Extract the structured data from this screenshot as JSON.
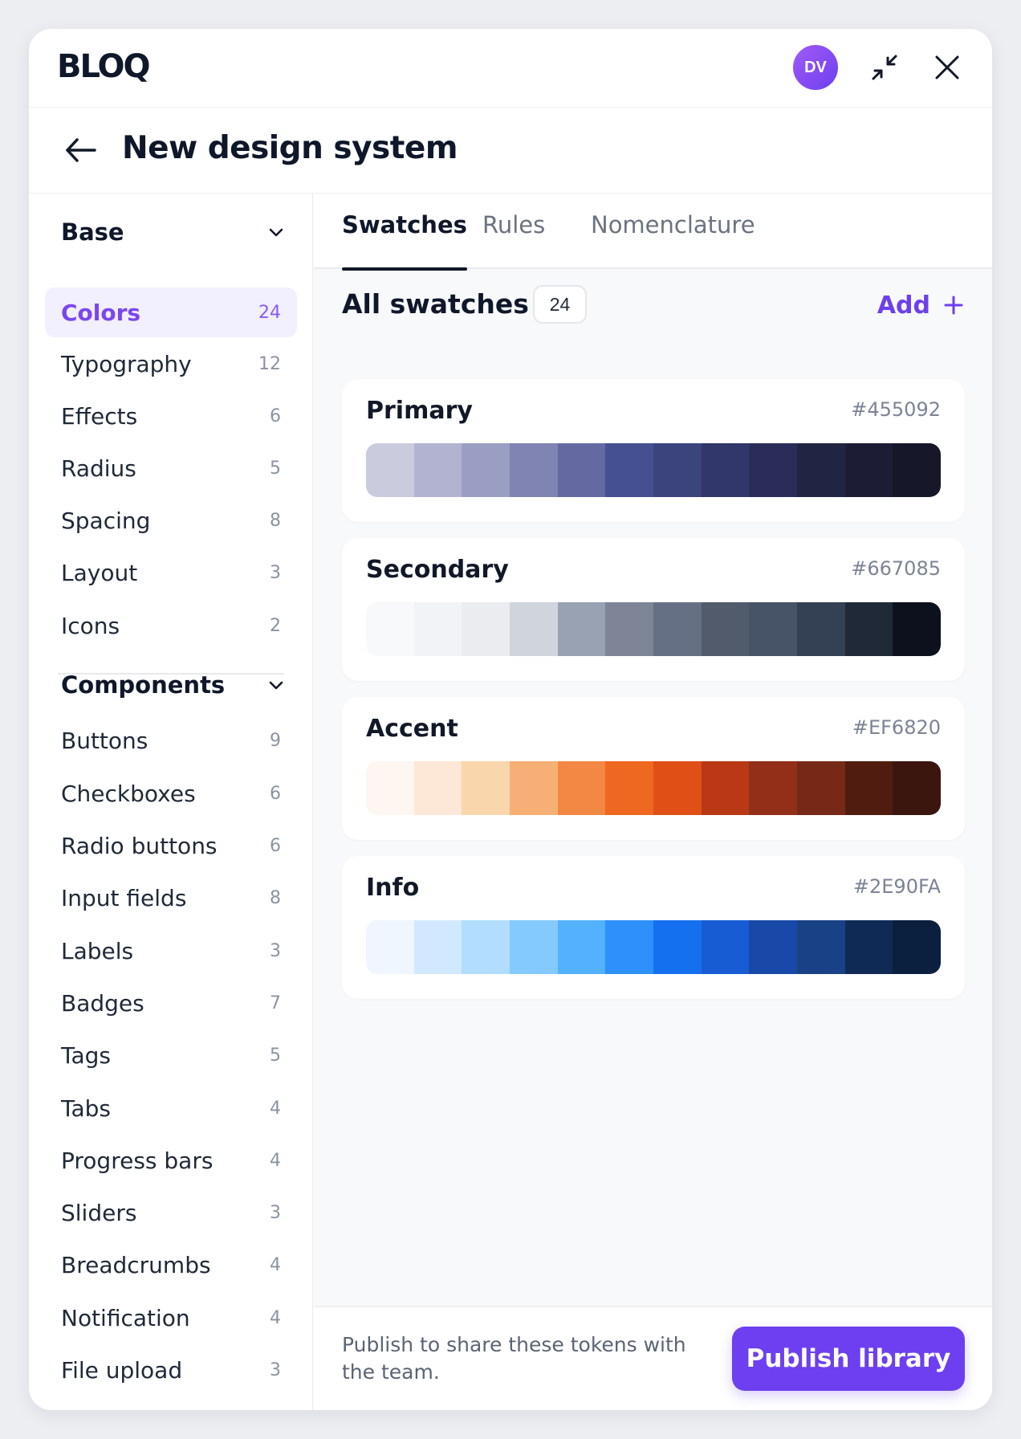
{
  "app": {
    "logo": "BLOQ",
    "avatar_initials": "DV",
    "minimize_icon": "minimize-arrows-icon",
    "close_icon": "close-icon"
  },
  "page": {
    "title": "New design system",
    "back_icon": "arrow-left-icon"
  },
  "sidebar": {
    "sections": [
      {
        "title": "Base",
        "items": [
          {
            "label": "Colors",
            "count": "24",
            "active": true
          },
          {
            "label": "Typography",
            "count": "12"
          },
          {
            "label": "Effects",
            "count": "6"
          },
          {
            "label": "Radius",
            "count": "5"
          },
          {
            "label": "Spacing",
            "count": "8"
          },
          {
            "label": "Layout",
            "count": "3"
          },
          {
            "label": "Icons",
            "count": "2"
          }
        ]
      },
      {
        "title": "Components",
        "items": [
          {
            "label": "Buttons",
            "count": "9"
          },
          {
            "label": "Checkboxes",
            "count": "6"
          },
          {
            "label": "Radio buttons",
            "count": "6"
          },
          {
            "label": "Input fields",
            "count": "8"
          },
          {
            "label": "Labels",
            "count": "3"
          },
          {
            "label": "Badges",
            "count": "7"
          },
          {
            "label": "Tags",
            "count": "5"
          },
          {
            "label": "Tabs",
            "count": "4"
          },
          {
            "label": "Progress bars",
            "count": "4"
          },
          {
            "label": "Sliders",
            "count": "3"
          },
          {
            "label": "Breadcrumbs",
            "count": "4"
          },
          {
            "label": "Notification",
            "count": "4"
          },
          {
            "label": "File upload",
            "count": "3"
          }
        ]
      }
    ]
  },
  "tabs": [
    {
      "label": "Swatches",
      "active": true
    },
    {
      "label": "Rules"
    },
    {
      "label": "Nomenclature"
    }
  ],
  "swatches": {
    "title": "All swatches",
    "count": "24",
    "add_label": "Add",
    "palettes": [
      {
        "name": "Primary",
        "hex": "#455092",
        "steps": [
          "#CACBDD",
          "#B2B3D0",
          "#9A9EC3",
          "#7F84B2",
          "#646AA1",
          "#455092",
          "#3C447E",
          "#31376A",
          "#292D57",
          "#212443",
          "#1C1D35",
          "#161728"
        ]
      },
      {
        "name": "Secondary",
        "hex": "#667085",
        "steps": [
          "#F8F9FB",
          "#F2F3F6",
          "#EAECF0",
          "#D0D5DD",
          "#98A2B3",
          "#7D8597",
          "#667085",
          "#525B6B",
          "#475467",
          "#344054",
          "#1F2937",
          "#0C111D"
        ]
      },
      {
        "name": "Accent",
        "hex": "#EF6820",
        "steps": [
          "#FEF6F1",
          "#FDE8D7",
          "#F9D6AC",
          "#F6AF75",
          "#F38744",
          "#EF6820",
          "#E04F16",
          "#B93815",
          "#932F19",
          "#772917",
          "#511C10",
          "#3B160F"
        ]
      },
      {
        "name": "Info",
        "hex": "#2E90FA",
        "steps": [
          "#EFF6FF",
          "#D1E9FF",
          "#B2DDFF",
          "#84CAFF",
          "#53B1FD",
          "#2E90FA",
          "#1570EF",
          "#175CD3",
          "#1849A9",
          "#194185",
          "#102A56",
          "#0B1F3F"
        ]
      }
    ]
  },
  "footer": {
    "text": "Publish to share these tokens with the team.",
    "publish_label": "Publish library"
  },
  "colors": {
    "accent": "#6D3FF0",
    "active_bg": "#F2EFFE",
    "text": "#0F172A"
  }
}
